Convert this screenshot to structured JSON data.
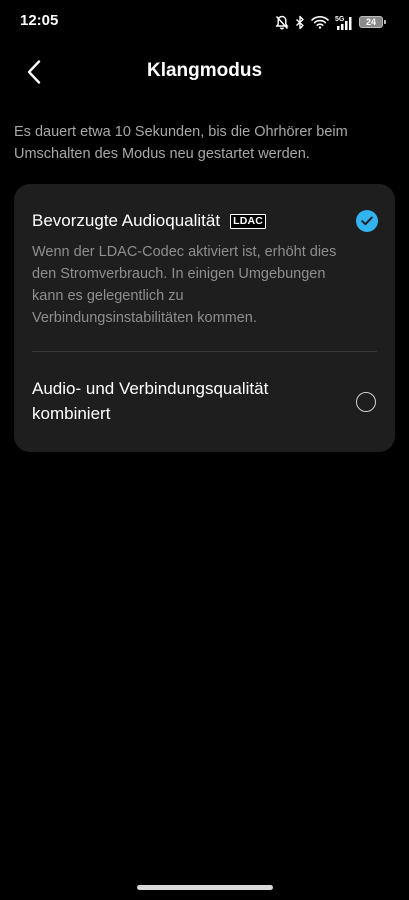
{
  "status_bar": {
    "time": "12:05",
    "network": "5G",
    "battery": "24",
    "icons": [
      "bell-off-icon",
      "bluetooth-icon",
      "wifi-icon",
      "signal-icon",
      "battery-icon"
    ]
  },
  "header": {
    "title": "Klangmodus",
    "back_icon": "chevron-left-icon"
  },
  "info_text": "Es dauert etwa 10 Sekunden, bis die Ohrhörer beim Umschalten des Modus neu gestartet werden.",
  "options": [
    {
      "title": "Bevorzugte Audioqualität",
      "badge": "LDAC",
      "description": "Wenn der LDAC-Codec aktiviert ist, erhöht dies den Stromverbrauch. In einigen Umgebungen kann es gelegentlich zu Verbindungsinstabilitäten kommen.",
      "selected": true
    },
    {
      "title": "Audio- und Verbindungsqualität kombiniert",
      "selected": false
    }
  ],
  "colors": {
    "background": "#000000",
    "card": "#1e1e1f",
    "accent": "#33b4f2",
    "secondary_text": "#a8a8a8"
  }
}
